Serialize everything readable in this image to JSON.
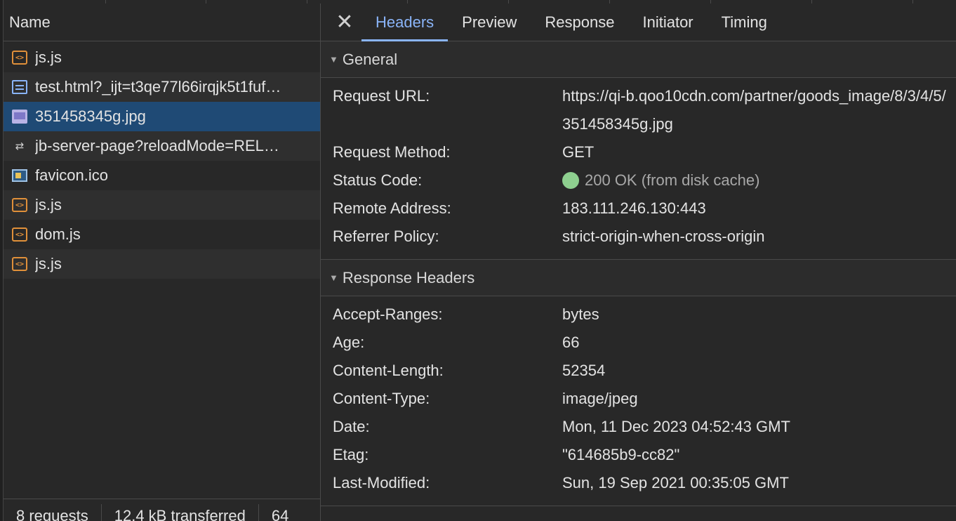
{
  "request_list": {
    "column_header": "Name",
    "items": [
      {
        "name": "js.js",
        "type": "script"
      },
      {
        "name": "test.html?_ijt=t3qe77l66irqjk5t1fuf…",
        "type": "document"
      },
      {
        "name": "351458345g.jpg",
        "type": "image",
        "selected": true
      },
      {
        "name": "jb-server-page?reloadMode=REL…",
        "type": "fetch"
      },
      {
        "name": "favicon.ico",
        "type": "favicon"
      },
      {
        "name": "js.js",
        "type": "script"
      },
      {
        "name": "dom.js",
        "type": "script"
      },
      {
        "name": "js.js",
        "type": "script"
      }
    ],
    "status": {
      "requests": "8 requests",
      "transferred": "12.4 kB transferred",
      "resources": "64"
    }
  },
  "detail": {
    "tabs": [
      "Headers",
      "Preview",
      "Response",
      "Initiator",
      "Timing"
    ],
    "active_tab": "Headers",
    "accent_color": "#8ab4f8",
    "general": {
      "title": "General",
      "request_url_label": "Request URL:",
      "request_url": "https://qi-b.qoo10cdn.com/partner/goods_image/8/3/4/5/351458345g.jpg",
      "request_method_label": "Request Method:",
      "request_method": "GET",
      "status_code_label": "Status Code:",
      "status_code": "200 OK (from disk cache)",
      "status_color": "#8ecf8f",
      "remote_address_label": "Remote Address:",
      "remote_address": "183.111.246.130:443",
      "referrer_policy_label": "Referrer Policy:",
      "referrer_policy": "strict-origin-when-cross-origin"
    },
    "response_headers": {
      "title": "Response Headers",
      "items": [
        {
          "key": "Accept-Ranges:",
          "value": "bytes"
        },
        {
          "key": "Age:",
          "value": "66"
        },
        {
          "key": "Content-Length:",
          "value": "52354"
        },
        {
          "key": "Content-Type:",
          "value": "image/jpeg"
        },
        {
          "key": "Date:",
          "value": "Mon, 11 Dec 2023 04:52:43 GMT"
        },
        {
          "key": "Etag:",
          "value": "\"614685b9-cc82\""
        },
        {
          "key": "Last-Modified:",
          "value": "Sun, 19 Sep 2021 00:35:05 GMT"
        }
      ]
    }
  }
}
